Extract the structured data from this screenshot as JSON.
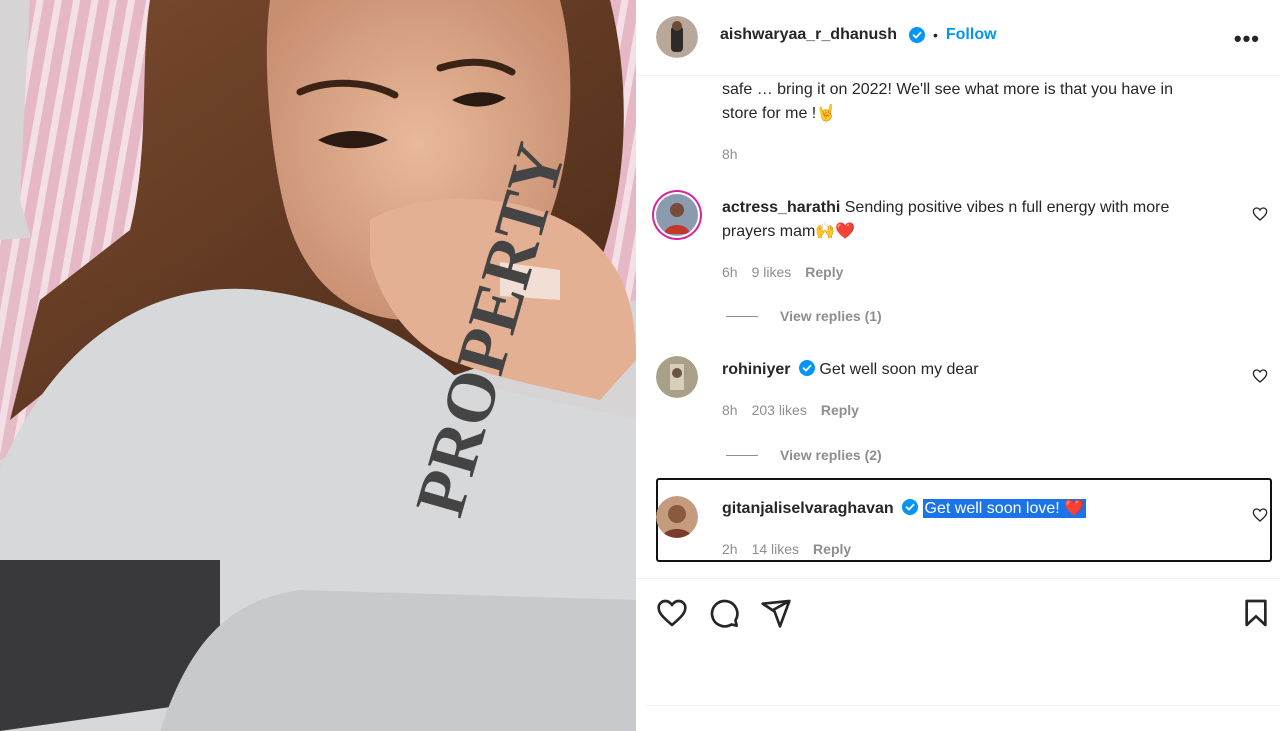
{
  "post": {
    "author": "aishwaryaa_r_dhanush",
    "follow_label": "Follow",
    "dot": "•",
    "more_label": "•••",
    "caption_lines": [
      "safe … bring it on 2022! We'll see what more is that you have in",
      "store for me !🤘"
    ],
    "caption_time": "8h"
  },
  "photo": {
    "shirt_text": "PROPERTY"
  },
  "comments": [
    {
      "username": "actress_harathi",
      "text_line1": "Sending positive vibes n full energy with more",
      "text_line2": "prayers mam🙌❤️",
      "time": "6h",
      "likes": "9 likes",
      "reply": "Reply",
      "view_replies": "View replies (1)"
    },
    {
      "username": "rohiniyer",
      "text": "Get well soon my dear",
      "time": "8h",
      "likes": "203 likes",
      "reply": "Reply",
      "view_replies": "View replies (2)"
    },
    {
      "username": "gitanjaliselvaraghavan",
      "text": "Get well soon love! ❤️",
      "time": "2h",
      "likes": "14 likes",
      "reply": "Reply"
    }
  ],
  "colors": {
    "verified_blue": "#0095f6",
    "follow_blue": "#0095f6",
    "selection_blue": "#1a73e8"
  },
  "icons": [
    "heart-icon",
    "comment-icon",
    "share-icon",
    "bookmark-icon",
    "verified-badge-icon",
    "more-options-icon"
  ]
}
